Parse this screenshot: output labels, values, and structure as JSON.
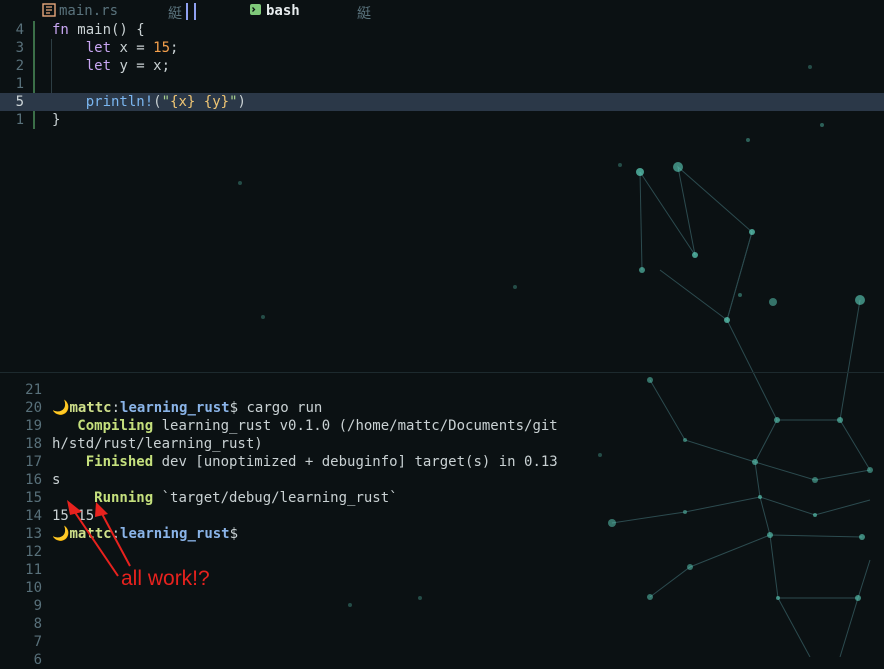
{
  "tabs": {
    "editor_file": "main.rs",
    "editor_marker": "綎",
    "terminal_name": "bash",
    "terminal_marker": "綎"
  },
  "editor": {
    "lines": [
      {
        "ln": "4",
        "parts": [
          [
            "kw",
            "fn"
          ],
          [
            "tx",
            " main() {"
          ]
        ]
      },
      {
        "ln": "3",
        "parts": [
          [
            "tx",
            "    "
          ],
          [
            "kw",
            "let"
          ],
          [
            "tx",
            " x = "
          ],
          [
            "num",
            "15"
          ],
          [
            "tx",
            ";"
          ]
        ]
      },
      {
        "ln": "2",
        "parts": [
          [
            "tx",
            "    "
          ],
          [
            "kw",
            "let"
          ],
          [
            "tx",
            " y = x;"
          ]
        ]
      },
      {
        "ln": "1",
        "parts": [
          [
            "tx",
            ""
          ]
        ]
      },
      {
        "ln": "5",
        "current": true,
        "parts": [
          [
            "tx",
            "    "
          ],
          [
            "fn",
            "println!"
          ],
          [
            "tx",
            "("
          ],
          [
            "str",
            "\""
          ],
          [
            "interp",
            "{x}"
          ],
          [
            "str",
            " "
          ],
          [
            "interp",
            "{y}"
          ],
          [
            "str",
            "\""
          ],
          [
            "tx",
            ")"
          ]
        ]
      },
      {
        "ln": "1",
        "parts": [
          [
            "tx",
            "}"
          ]
        ]
      }
    ]
  },
  "terminal": {
    "line_numbers": [
      "21",
      "20",
      "19",
      "18",
      "17",
      "16",
      "15",
      "14",
      "13",
      "12",
      "11",
      "10",
      "9",
      "8",
      "7",
      "6"
    ],
    "prompt_user": "mattc",
    "prompt_sep": ":",
    "prompt_path": "learning_rust",
    "prompt_dollar": "$",
    "command": " cargo run",
    "compiling_label": "   Compiling",
    "compiling_text": " learning_rust v0.1.0 (/home/mattc/Documents/git",
    "compiling_wrap": "h/std/rust/learning_rust)",
    "finished_label": "    Finished",
    "finished_text": " dev [unoptimized + debuginfo] target(s) in 0.13",
    "finished_wrap": "s",
    "running_label": "     Running",
    "running_text": " `target/debug/learning_rust`",
    "output": "15 15",
    "moon": "🌙"
  },
  "annotation": {
    "text": "all work!?",
    "color": "#e8221e"
  },
  "colors": {
    "background": "#0b1113",
    "current_line": "#2b3848",
    "keyword": "#c8a6f2",
    "number": "#f5a04c",
    "function": "#7bb6f0",
    "prompt_user": "#cfe08a",
    "prompt_path": "#8ab4e8"
  }
}
